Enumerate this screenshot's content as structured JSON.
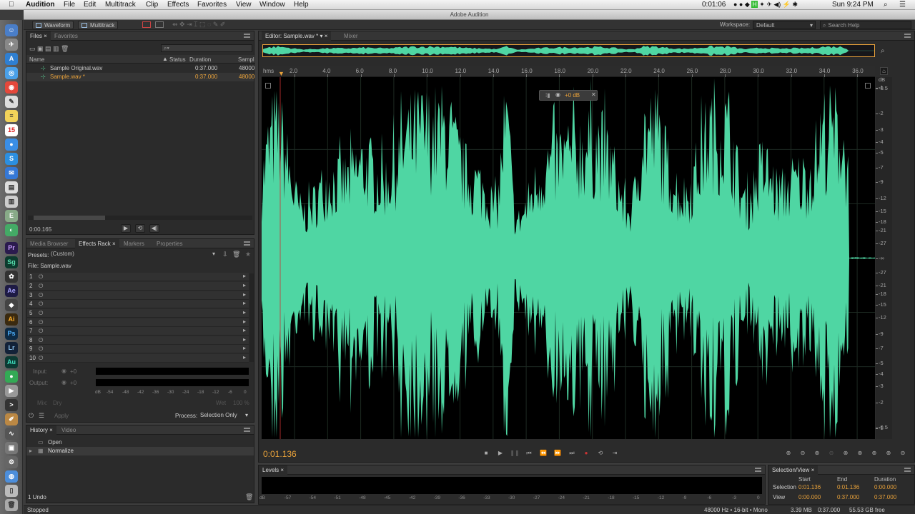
{
  "menubar": {
    "app": "Audition",
    "items": [
      "File",
      "Edit",
      "Multitrack",
      "Clip",
      "Effects",
      "Favorites",
      "View",
      "Window",
      "Help"
    ],
    "timer": "0:01:06",
    "clock": "Sun 9:24 PM"
  },
  "window_title": "Adobe Audition",
  "toolbar": {
    "waveform": "Waveform",
    "multitrack": "Multitrack",
    "workspace_label": "Workspace:",
    "workspace_value": "Default",
    "search_placeholder": "Search Help"
  },
  "files_panel": {
    "tabs": [
      "Files",
      "Favorites"
    ],
    "columns": {
      "name": "Name",
      "status": "Status",
      "duration": "Duration",
      "rate": "Sampl"
    },
    "files": [
      {
        "name": "Sample Original.wav",
        "duration": "0:37.000",
        "rate": "48000"
      },
      {
        "name": "Sample.wav *",
        "duration": "0:37.000",
        "rate": "48000"
      }
    ],
    "time": "0:00.165"
  },
  "effects_panel": {
    "tabs": [
      "Media Browser",
      "Effects Rack",
      "Markers",
      "Properties"
    ],
    "presets_label": "Presets:",
    "presets_value": "(Custom)",
    "file_label": "File: Sample.wav",
    "slots": [
      "1",
      "2",
      "3",
      "4",
      "5",
      "6",
      "7",
      "8",
      "9",
      "10"
    ],
    "input_label": "Input:",
    "output_label": "Output:",
    "gain_in": "+0",
    "gain_out": "+0",
    "meter_ticks": [
      "dB",
      "-54",
      "-48",
      "-42",
      "-36",
      "-30",
      "-24",
      "-18",
      "-12",
      "-6",
      "0"
    ],
    "mix_label": "Mix:",
    "dry": "Dry",
    "wet": "Wet",
    "wet_pct": "100 %",
    "apply": "Apply",
    "process_label": "Process:",
    "process_value": "Selection Only"
  },
  "history_panel": {
    "tabs": [
      "History",
      "Video"
    ],
    "items": [
      "Open",
      "Normalize"
    ],
    "undo": "1 Undo"
  },
  "editor": {
    "tabs": [
      "Editor: Sample.wav *",
      "Mixer"
    ],
    "time_unit": "hms",
    "time_labels": [
      "2.0",
      "4.0",
      "6.0",
      "8.0",
      "10.0",
      "12.0",
      "14.0",
      "16.0",
      "18.0",
      "20.0",
      "22.0",
      "24.0",
      "26.0",
      "28.0",
      "30.0",
      "32.0",
      "34.0",
      "36.0"
    ],
    "db_labels": [
      "dB",
      "-0.5",
      "-1",
      "-2",
      "-3",
      "-4",
      "-5",
      "-7",
      "-9",
      "-12",
      "-15",
      "-18",
      "-21",
      "-27",
      "-∞",
      "-27",
      "-21",
      "-18",
      "-15",
      "-12",
      "-9",
      "-7",
      "-5",
      "-4",
      "-3",
      "-2",
      "-1",
      "-0.5"
    ],
    "hud_gain": "+0 dB",
    "current_time": "0:01.136",
    "wave_color": "#4fd6a3"
  },
  "levels_panel": {
    "title": "Levels",
    "ticks": [
      "dB",
      "-57",
      "-54",
      "-51",
      "-48",
      "-45",
      "-42",
      "-39",
      "-36",
      "-33",
      "-30",
      "-27",
      "-24",
      "-21",
      "-18",
      "-15",
      "-12",
      "-9",
      "-6",
      "-3",
      "0"
    ]
  },
  "selection_panel": {
    "title": "Selection/View",
    "headers": [
      "Start",
      "End",
      "Duration"
    ],
    "rows": [
      {
        "label": "Selection",
        "start": "0:01.136",
        "end": "0:01.136",
        "duration": "0:00.000"
      },
      {
        "label": "View",
        "start": "0:00.000",
        "end": "0:37.000",
        "duration": "0:37.000"
      }
    ]
  },
  "statusbar": {
    "state": "Stopped",
    "format": "48000 Hz • 16-bit • Mono",
    "size": "3.39 MB",
    "duration": "0:37.000",
    "free": "55.53 GB free"
  }
}
